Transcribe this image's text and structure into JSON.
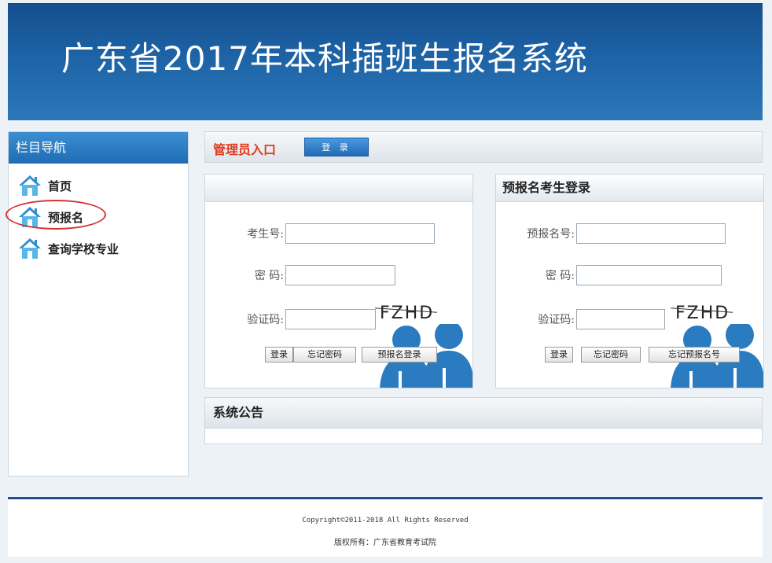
{
  "banner": {
    "title": "广东省2017年本科插班生报名系统"
  },
  "sidebar": {
    "title": "栏目导航",
    "items": [
      {
        "label": "首页",
        "icon": "home-icon"
      },
      {
        "label": "预报名",
        "icon": "home-icon"
      },
      {
        "label": "查询学校专业",
        "icon": "home-icon"
      }
    ]
  },
  "admin": {
    "title": "管理员入口",
    "login_label": "登 录"
  },
  "candidate_login": {
    "title": "",
    "id_label": "考生号:",
    "password_label": "密  码:",
    "captcha_label": "验证码:",
    "captcha_text": "FZHD",
    "buttons": {
      "login": "登录",
      "forgot_password": "忘记密码",
      "prereg_login": "预报名登录"
    }
  },
  "prereg_login": {
    "title": "预报名考生登录",
    "id_label": "预报名号:",
    "password_label": "密  码:",
    "captcha_label": "验证码:",
    "captcha_text": "FZHD",
    "buttons": {
      "login": "登录",
      "forgot_password": "忘记密码",
      "forgot_prereg_number": "忘记预报名号"
    }
  },
  "notice": {
    "title": "系统公告"
  },
  "footer": {
    "copyright": "Copyright©2011-2018 All Rights Reserved",
    "owner": "版权所有：广东省教育考试院"
  },
  "colors": {
    "brand_blue": "#1d63a6",
    "accent_red": "#e03a20",
    "highlight_circle": "#d63333"
  }
}
